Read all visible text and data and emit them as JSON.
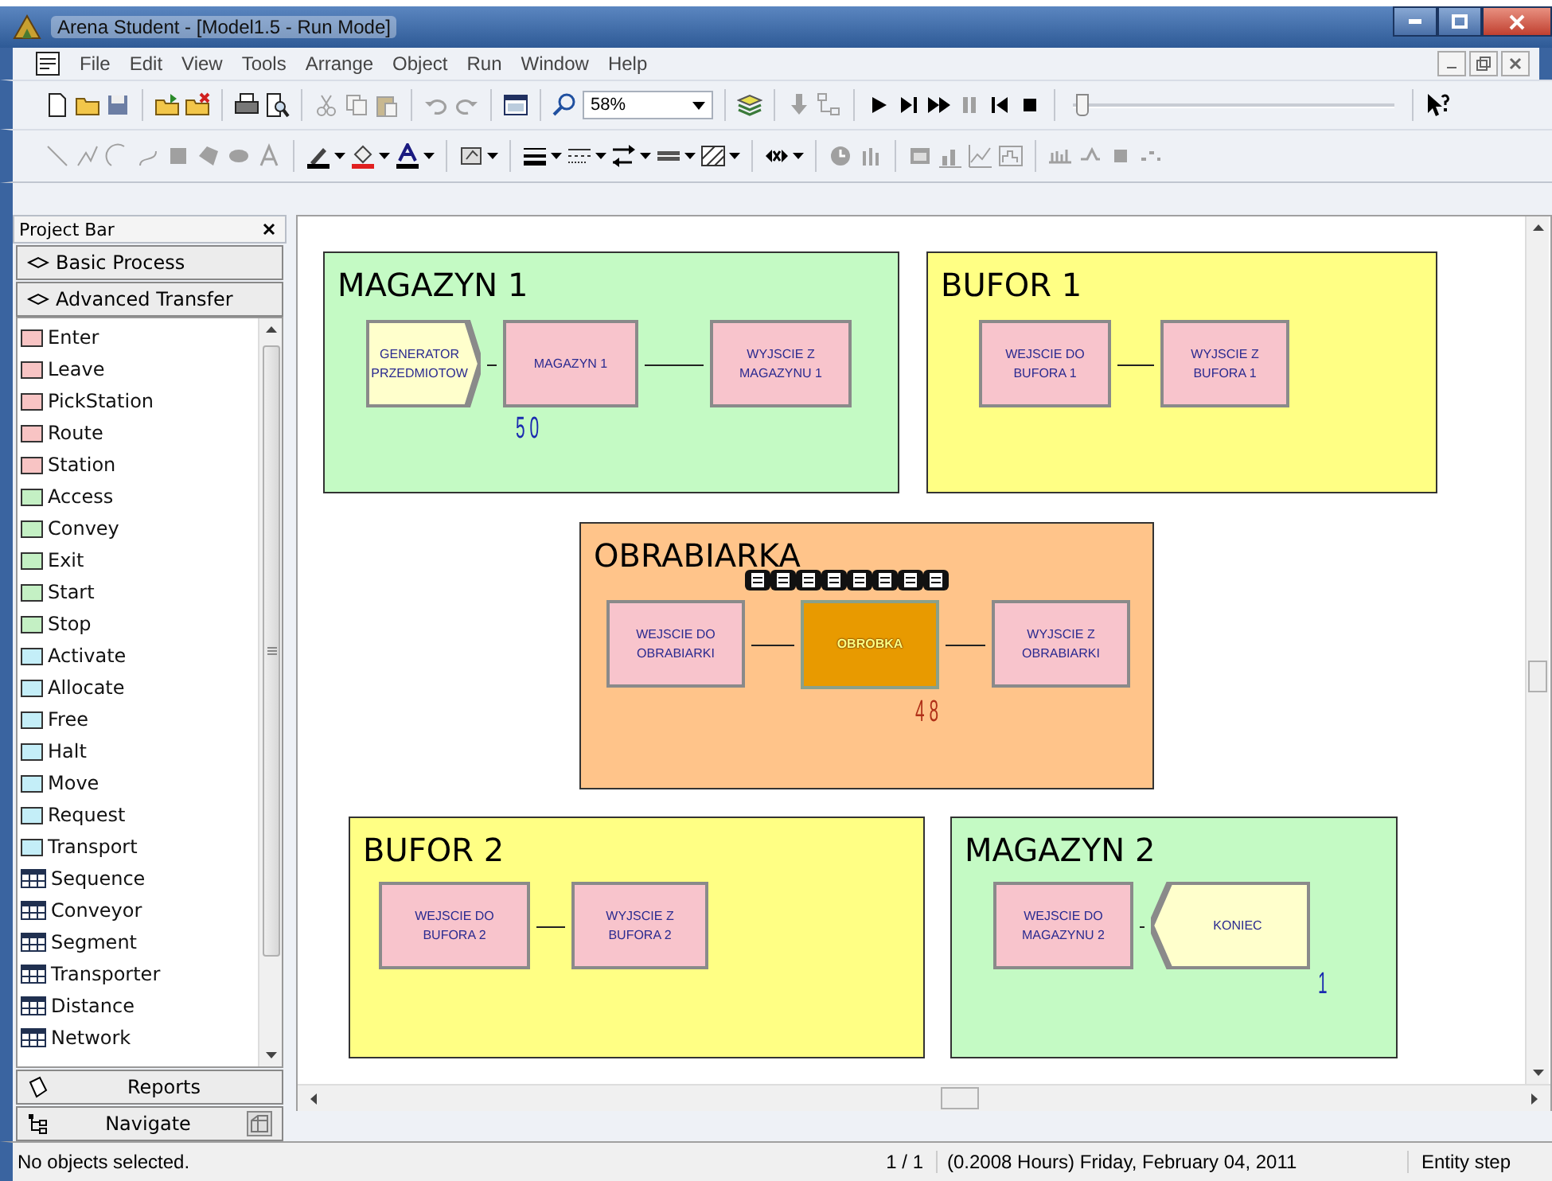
{
  "window": {
    "title": "Arena Student - [Model1.5 - Run Mode]"
  },
  "menu": {
    "items": [
      "File",
      "Edit",
      "View",
      "Tools",
      "Arrange",
      "Object",
      "Run",
      "Window",
      "Help"
    ]
  },
  "toolbar": {
    "zoom": "58%",
    "speed_slider": {
      "level": 0.03
    }
  },
  "project_bar": {
    "title": "Project Bar",
    "panels": [
      "Basic Process",
      "Advanced Transfer"
    ],
    "items": [
      {
        "label": "Enter",
        "kind": "module",
        "color": "#f8c4c4"
      },
      {
        "label": "Leave",
        "kind": "module",
        "color": "#f8c4c4"
      },
      {
        "label": "PickStation",
        "kind": "module",
        "color": "#f8c4c4"
      },
      {
        "label": "Route",
        "kind": "module",
        "color": "#f8c4c4"
      },
      {
        "label": "Station",
        "kind": "module",
        "color": "#f8c4c4"
      },
      {
        "label": "Access",
        "kind": "module",
        "color": "#c4f0c4"
      },
      {
        "label": "Convey",
        "kind": "module",
        "color": "#c4f0c4"
      },
      {
        "label": "Exit",
        "kind": "module",
        "color": "#c4f0c4"
      },
      {
        "label": "Start",
        "kind": "module",
        "color": "#c4f0c4"
      },
      {
        "label": "Stop",
        "kind": "module",
        "color": "#c4f0c4"
      },
      {
        "label": "Activate",
        "kind": "module",
        "color": "#c4eef8"
      },
      {
        "label": "Allocate",
        "kind": "module",
        "color": "#c4eef8"
      },
      {
        "label": "Free",
        "kind": "module",
        "color": "#c4eef8"
      },
      {
        "label": "Halt",
        "kind": "module",
        "color": "#c4eef8"
      },
      {
        "label": "Move",
        "kind": "module",
        "color": "#c4eef8"
      },
      {
        "label": "Request",
        "kind": "module",
        "color": "#c4eef8"
      },
      {
        "label": "Transport",
        "kind": "module",
        "color": "#c4eef8"
      },
      {
        "label": "Sequence",
        "kind": "data"
      },
      {
        "label": "Conveyor",
        "kind": "data"
      },
      {
        "label": "Segment",
        "kind": "data"
      },
      {
        "label": "Transporter",
        "kind": "data"
      },
      {
        "label": "Distance",
        "kind": "data"
      },
      {
        "label": "Network",
        "kind": "data"
      }
    ],
    "bottom_panels": [
      "Reports",
      "Navigate"
    ]
  },
  "canvas": {
    "areas": [
      {
        "title": "MAGAZYN 1",
        "color": "#c4fac4",
        "modules": [
          {
            "kind": "create",
            "label": "GENERATOR PRZEDMIOTOW",
            "busy": false,
            "counter": "5 0"
          },
          {
            "kind": "process",
            "label": "MAGAZYN 1",
            "busy": false
          },
          {
            "kind": "process",
            "label": "WYJSCIE Z MAGAZYNU 1",
            "busy": false
          }
        ]
      },
      {
        "title": "BUFOR 1",
        "color": "#ffff84",
        "modules": [
          {
            "kind": "process",
            "label": "WEJSCIE DO BUFORA 1",
            "busy": false
          },
          {
            "kind": "process",
            "label": "WYJSCIE Z BUFORA 1",
            "busy": false
          }
        ]
      },
      {
        "title": "OBRABIARKA",
        "color": "#ffc48a",
        "modules": [
          {
            "kind": "process",
            "label": "WEJSCIE DO OBRABIARKI",
            "busy": false
          },
          {
            "kind": "process",
            "label": "OBROBKA",
            "busy": true,
            "counter": "4 8",
            "queue": [
              {
                "kind": "entity"
              },
              {
                "kind": "entity"
              },
              {
                "kind": "entity"
              },
              {
                "kind": "entity"
              },
              {
                "kind": "entity"
              },
              {
                "kind": "entity"
              },
              {
                "kind": "entity"
              },
              {
                "kind": "entity"
              }
            ]
          },
          {
            "kind": "process",
            "label": "WYJSCIE Z OBRABIARKI",
            "busy": false
          }
        ]
      },
      {
        "title": "BUFOR 2",
        "color": "#ffff84",
        "modules": [
          {
            "kind": "process",
            "label": "WEJSCIE DO BUFORA 2",
            "busy": false
          },
          {
            "kind": "process",
            "label": "WYJSCIE Z BUFORA 2",
            "busy": false
          }
        ]
      },
      {
        "title": "MAGAZYN 2",
        "color": "#c4fac4",
        "modules": [
          {
            "kind": "process",
            "label": "WEJSCIE DO MAGAZYNU 2",
            "busy": false
          },
          {
            "kind": "dispose",
            "label": "KONIEC",
            "busy": false,
            "counter": "1"
          }
        ]
      }
    ]
  },
  "status_bar": {
    "message": "No objects selected.",
    "page": "1 / 1",
    "time": "(0.2008 Hours) Friday, February 04, 2011",
    "mode": "Entity step"
  }
}
